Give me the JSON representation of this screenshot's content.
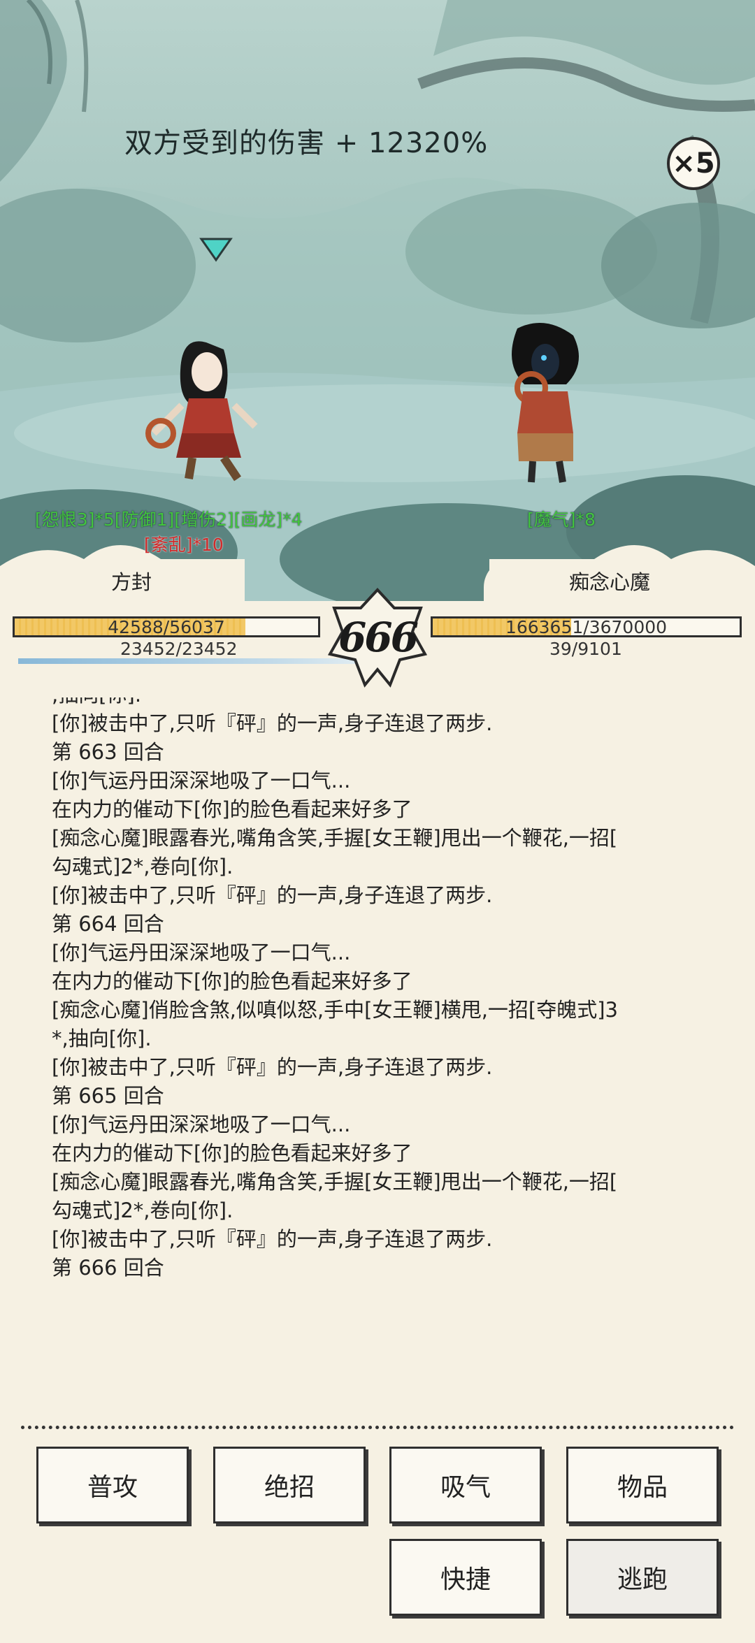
{
  "scene": {
    "damage_banner": "双方受到的伤害 + 12320%",
    "speed_multiplier": "×5",
    "player_buffs_line1": "[怨恨3]*5[防御1][增伤2][画龙]*4",
    "player_buffs_line2": "[紊乱]*10",
    "enemy_buffs": "[魔气]*8"
  },
  "player": {
    "name": "方封",
    "hp_text": "42588/56037",
    "hp_fraction": 0.76,
    "mp_text": "23452/23452",
    "mp_fraction": 1.0
  },
  "enemy": {
    "name": "痴念心魔",
    "hp_text": "1663651/3670000",
    "hp_fraction": 0.45,
    "mp_text": "39/9101"
  },
  "round_number": "666",
  "log": {
    "clipped_line": ",抽向[你].",
    "lines": [
      "[你]被击中了,只听『砰』的一声,身子连退了两步.",
      "第 663 回合",
      "[你]气运丹田深深地吸了一口气...",
      "在内力的催动下[你]的脸色看起来好多了",
      "[痴念心魔]眼露春光,嘴角含笑,手握[女王鞭]甩出一个鞭花,一招[\n勾魂式]2*,卷向[你].",
      "[你]被击中了,只听『砰』的一声,身子连退了两步.",
      "第 664 回合",
      "[你]气运丹田深深地吸了一口气...",
      "在内力的催动下[你]的脸色看起来好多了",
      "[痴念心魔]俏脸含煞,似嗔似怒,手中[女王鞭]横甩,一招[夺魄式]3\n*,抽向[你].",
      "[你]被击中了,只听『砰』的一声,身子连退了两步.",
      "第 665 回合",
      "[你]气运丹田深深地吸了一口气...",
      "在内力的催动下[你]的脸色看起来好多了",
      "[痴念心魔]眼露春光,嘴角含笑,手握[女王鞭]甩出一个鞭花,一招[\n勾魂式]2*,卷向[你].",
      "[你]被击中了,只听『砰』的一声,身子连退了两步.",
      "第 666 回合"
    ]
  },
  "actions": {
    "attack": "普攻",
    "ultimate": "绝招",
    "breathe": "吸气",
    "items": "物品",
    "shortcut": "快捷",
    "flee": "逃跑"
  },
  "colors": {
    "buff_green": "#43c43e",
    "debuff_red": "#d02a2a",
    "hp_fill": "#f2c866",
    "panel_bg": "#f6f1e3"
  }
}
